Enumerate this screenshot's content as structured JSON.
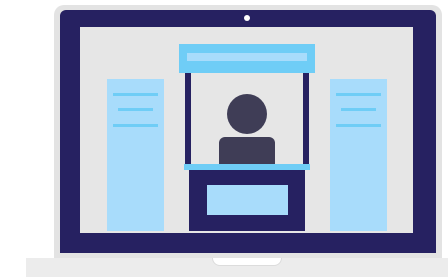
{
  "illustration": {
    "subject": "laptop-with-booth-kiosk",
    "icons": [
      "laptop-icon",
      "camera-dot-icon",
      "kiosk-booth-icon",
      "person-avatar-icon",
      "banner-stand-icon"
    ]
  },
  "colors": {
    "frame_outer": "#e3e3e3",
    "bezel": "#262161",
    "screen": "#e6e6e6",
    "accent_light": "#a8dcfb",
    "accent_mid": "#6fcdf6",
    "person": "#3f3d56",
    "base": "#ececec",
    "camera": "#ffffff"
  }
}
